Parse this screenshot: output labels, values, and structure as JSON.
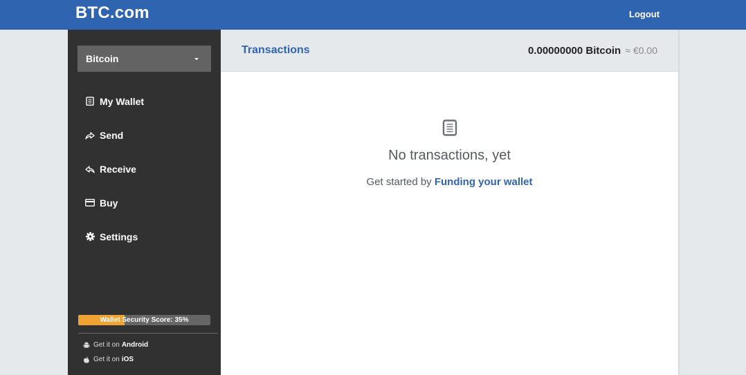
{
  "header": {
    "logo": "BTC.com",
    "logout_label": "Logout"
  },
  "sidebar": {
    "currency_select": "Bitcoin",
    "items": [
      {
        "label": "My Wallet",
        "icon": "document-icon"
      },
      {
        "label": "Send",
        "icon": "share-arrow-icon"
      },
      {
        "label": "Receive",
        "icon": "reply-arrow-icon"
      },
      {
        "label": "Buy",
        "icon": "credit-card-icon"
      },
      {
        "label": "Settings",
        "icon": "gear-icon"
      }
    ],
    "security_score": {
      "label": "Wallet Security Score: 35%",
      "percent": 35
    },
    "apps": [
      {
        "prefix": "Get it on",
        "platform": "Android",
        "icon": "android-icon"
      },
      {
        "prefix": "Get it on",
        "platform": "iOS",
        "icon": "apple-icon"
      }
    ]
  },
  "main": {
    "title": "Transactions",
    "balance": "0.00000000 Bitcoin",
    "fiat": "≈ €0.00",
    "empty_title": "No transactions, yet",
    "empty_prefix": "Get started by",
    "empty_link": "Funding your wallet"
  },
  "colors": {
    "brand": "#2f64b0",
    "sidebar": "#313131",
    "security_fill": "#f0a233"
  }
}
